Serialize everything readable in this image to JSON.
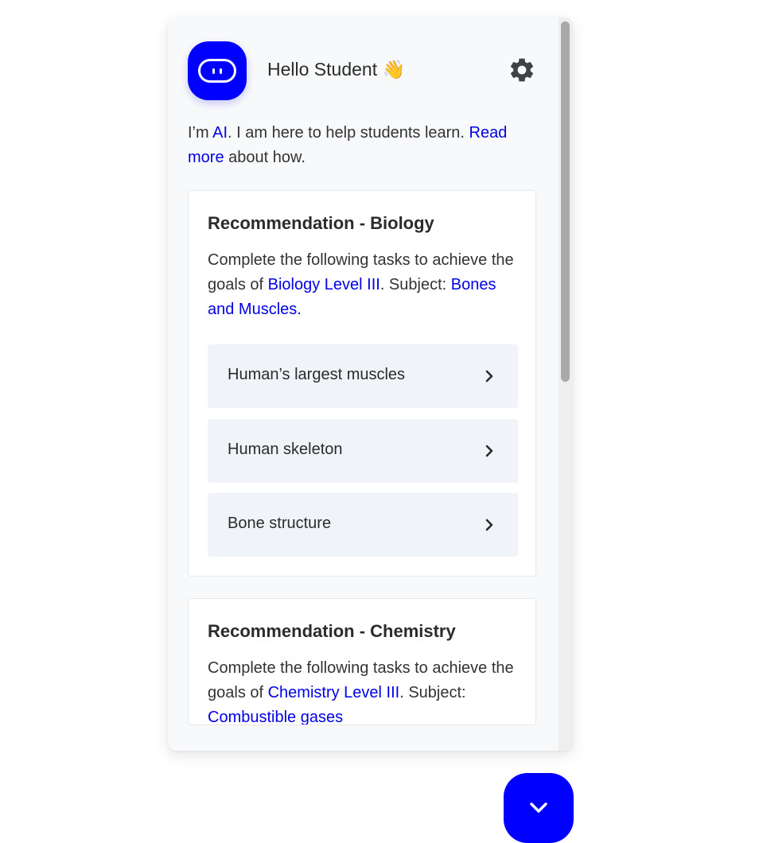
{
  "header": {
    "greeting": "Hello Student 👋",
    "avatar_icon": "robot-face-icon",
    "settings_icon": "gear-icon"
  },
  "intro": {
    "prefix": "I’m ",
    "ai_link": "AI",
    "middle": ". I am here to help students learn. ",
    "read_more_link": "Read more",
    "suffix": " about how."
  },
  "cards": [
    {
      "title": "Recommendation - Biology",
      "text_prefix": "Complete the following tasks to achieve the goals of ",
      "level_link": "Biology Level III",
      "text_middle": ". Subject: ",
      "subject_link": "Bones and Muscles.",
      "tasks": [
        {
          "label": "Human’s largest muscles"
        },
        {
          "label": "Human skeleton"
        },
        {
          "label": "Bone structure"
        }
      ]
    },
    {
      "title": "Recommendation - Chemistry",
      "text_prefix": "Complete the following tasks to achieve the goals of ",
      "level_link": "Chemistry Level III",
      "text_middle": ". Subject: ",
      "subject_link": "Combustible gases"
    }
  ],
  "fab": {
    "icon": "chevron-down-icon"
  },
  "colors": {
    "accent": "#0000ff",
    "link": "#0000e6",
    "panel_bg": "#f8f9fa",
    "task_bg": "#f0f4f8"
  }
}
